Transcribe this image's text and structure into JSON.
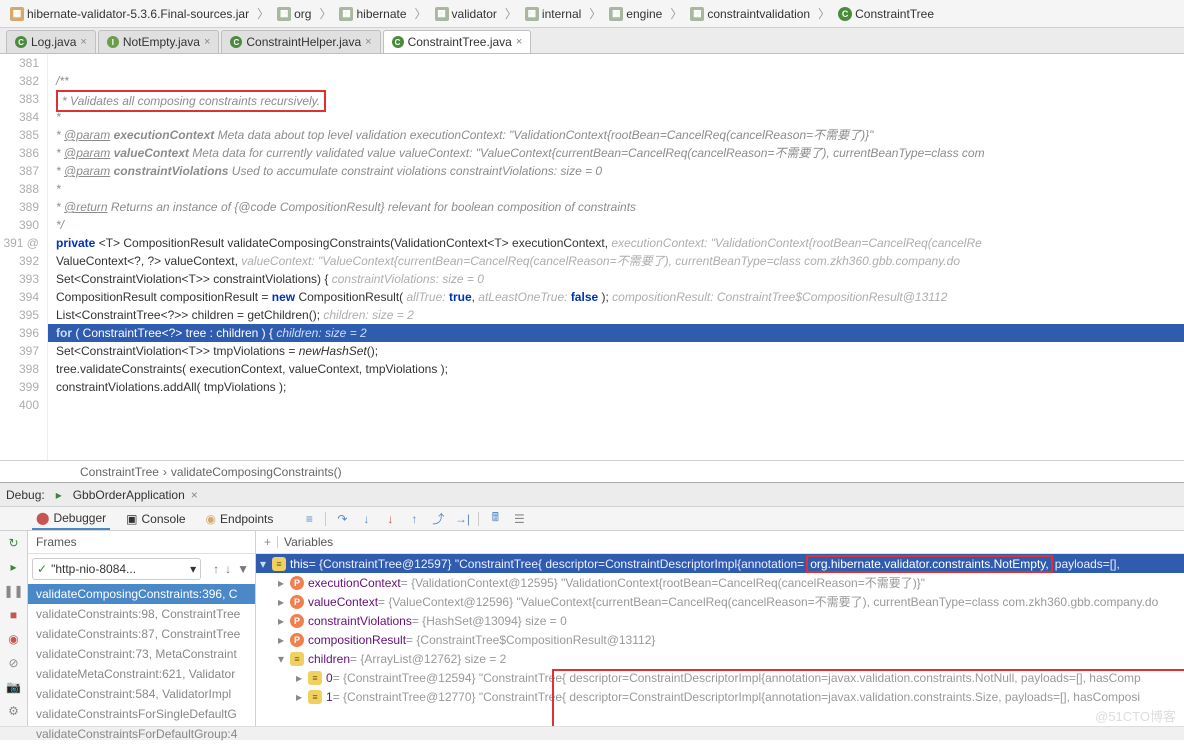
{
  "breadcrumb": [
    {
      "icon": "jar",
      "label": "hibernate-validator-5.3.6.Final-sources.jar"
    },
    {
      "icon": "pkg",
      "label": "org"
    },
    {
      "icon": "pkg",
      "label": "hibernate"
    },
    {
      "icon": "pkg",
      "label": "validator"
    },
    {
      "icon": "pkg",
      "label": "internal"
    },
    {
      "icon": "pkg",
      "label": "engine"
    },
    {
      "icon": "pkg",
      "label": "constraintvalidation"
    },
    {
      "icon": "class",
      "label": "ConstraintTree"
    }
  ],
  "tabs": [
    {
      "icon": "c",
      "label": "Log.java",
      "active": false
    },
    {
      "icon": "i",
      "label": "NotEmpty.java",
      "active": false
    },
    {
      "icon": "c",
      "label": "ConstraintHelper.java",
      "active": false
    },
    {
      "icon": "c",
      "label": "ConstraintTree.java",
      "active": true
    }
  ],
  "gutter_start": 381,
  "gutter_end": 400,
  "marker_at": 391,
  "code_lines": [
    {
      "html": ""
    },
    {
      "html": "    <span class='comment'>/**</span>"
    },
    {
      "html": "     <span class='red-box'><span class='comment'>* Validates all composing constraints recursively.</span></span>"
    },
    {
      "html": "     <span class='comment'>*</span>"
    },
    {
      "html": "     <span class='comment'>* <span class='tag'>@param</span> <span class='bold'>executionContext</span> Meta data about top level validation  executionContext: \"ValidationContext{rootBean=CancelReq(cancelReason=不需要了)}\"</span>"
    },
    {
      "html": "     <span class='comment'>* <span class='tag'>@param</span> <span class='bold'>valueContext</span> Meta data for currently validated value  valueContext: \"ValueContext{currentBean=CancelReq(cancelReason=不需要了), currentBeanType=class com</span>"
    },
    {
      "html": "     <span class='comment'>* <span class='tag'>@param</span> <span class='bold'>constraintViolations</span> Used to accumulate constraint violations  constraintViolations:  size = 0</span>"
    },
    {
      "html": "     <span class='comment'>*</span>"
    },
    {
      "html": "     <span class='comment'>* <span class='tag'>@return</span> Returns an instance of {@code CompositionResult} relevant for boolean composition of constraints</span>"
    },
    {
      "html": "     <span class='comment'>*/</span>"
    },
    {
      "html": "    <span class='kw'>private</span> &lt;T&gt; CompositionResult validateComposingConstraints(ValidationContext&lt;T&gt; executionContext,  <span class='hint'>executionContext: \"ValidationContext{rootBean=CancelReq(cancelRe</span>"
    },
    {
      "html": "            ValueContext&lt;?, ?&gt; valueContext,  <span class='hint'>valueContext: \"ValueContext{currentBean=CancelReq(cancelReason=不需要了), currentBeanType=class com.zkh360.gbb.company.do</span>"
    },
    {
      "html": "            Set&lt;ConstraintViolation&lt;T&gt;&gt; constraintViolations) {   <span class='hint'>constraintViolations:  size = 0</span>"
    },
    {
      "html": "        CompositionResult compositionResult = <span class='kw'>new</span> CompositionResult( <span class='hint'>allTrue:</span> <span class='kw'>true</span>,  <span class='hint'>atLeastOneTrue:</span> <span class='kw'>false</span> );  <span class='hint'>compositionResult: ConstraintTree$CompositionResult@13112</span>"
    },
    {
      "html": "        List&lt;ConstraintTree&lt;?&gt;&gt; children = getChildren();  <span class='hint'>children:  size = 2</span>"
    },
    {
      "html": "        <span class='kw'>for</span> ( ConstraintTree&lt;?&gt; tree : children ) {   <span class='hint'>children:  size = 2</span>",
      "hl": true
    },
    {
      "html": "            Set&lt;ConstraintViolation&lt;T&gt;&gt; tmpViolations = <i>newHashSet</i>();"
    },
    {
      "html": "            tree.validateConstraints( executionContext, valueContext, tmpViolations );"
    },
    {
      "html": "            constraintViolations.addAll( tmpViolations );"
    },
    {
      "html": ""
    }
  ],
  "method_breadcrumb": [
    "ConstraintTree",
    "validateComposingConstraints()"
  ],
  "debug": {
    "label": "Debug:",
    "config": "GbbOrderApplication",
    "tabs": [
      "Debugger",
      "Console",
      "Endpoints"
    ],
    "frames_title": "Frames",
    "variables_title": "Variables",
    "thread": "\"http-nio-8084...",
    "frames": [
      {
        "label": "validateComposingConstraints:396, C",
        "active": true
      },
      {
        "label": "validateConstraints:98, ConstraintTree"
      },
      {
        "label": "validateConstraints:87, ConstraintTree"
      },
      {
        "label": "validateConstraint:73, MetaConstraint"
      },
      {
        "label": "validateMetaConstraint:621, Validator"
      },
      {
        "label": "validateConstraint:584, ValidatorImpl"
      },
      {
        "label": "validateConstraintsForSingleDefaultG"
      },
      {
        "label": "validateConstraintsForDefaultGroup:4"
      }
    ],
    "vars": [
      {
        "indent": 0,
        "chev": "▾",
        "icon": "this",
        "name": "this",
        "rest": " = {ConstraintTree@12597} \"ConstraintTree{ descriptor=ConstraintDescriptorImpl{annotation=",
        "boxed": "org.hibernate.validator.constraints.NotEmpty,",
        "tail": " payloads=[],",
        "selected": true
      },
      {
        "indent": 1,
        "chev": "▸",
        "icon": "p",
        "name": "executionContext",
        "rest": " = {ValidationContext@12595} \"ValidationContext{rootBean=CancelReq(cancelReason=不需要了)}\""
      },
      {
        "indent": 1,
        "chev": "▸",
        "icon": "p",
        "name": "valueContext",
        "rest": " = {ValueContext@12596} \"ValueContext{currentBean=CancelReq(cancelReason=不需要了), currentBeanType=class com.zkh360.gbb.company.do"
      },
      {
        "indent": 1,
        "chev": "▸",
        "icon": "p",
        "name": "constraintViolations",
        "rest": " = {HashSet@13094}  size = 0"
      },
      {
        "indent": 1,
        "chev": "▸",
        "icon": "p",
        "name": "compositionResult",
        "rest": " = {ConstraintTree$CompositionResult@13112}"
      },
      {
        "indent": 1,
        "chev": "▾",
        "icon": "e",
        "name": "children",
        "rest": " = {ArrayList@12762}  size = 2"
      },
      {
        "indent": 2,
        "chev": "▸",
        "icon": "e",
        "name": "0",
        "rest": " = {ConstraintTree@12594} \"ConstraintTree{ descriptor=ConstraintDescriptorImpl{annotation=javax.validation.constraints.NotNull, payloads=[], hasComp"
      },
      {
        "indent": 2,
        "chev": "▸",
        "icon": "e",
        "name": "1",
        "rest": " = {ConstraintTree@12770} \"ConstraintTree{ descriptor=ConstraintDescriptorImpl{annotation=javax.validation.constraints.Size, payloads=[], hasComposi"
      }
    ]
  },
  "watermark": "@51CTO博客"
}
